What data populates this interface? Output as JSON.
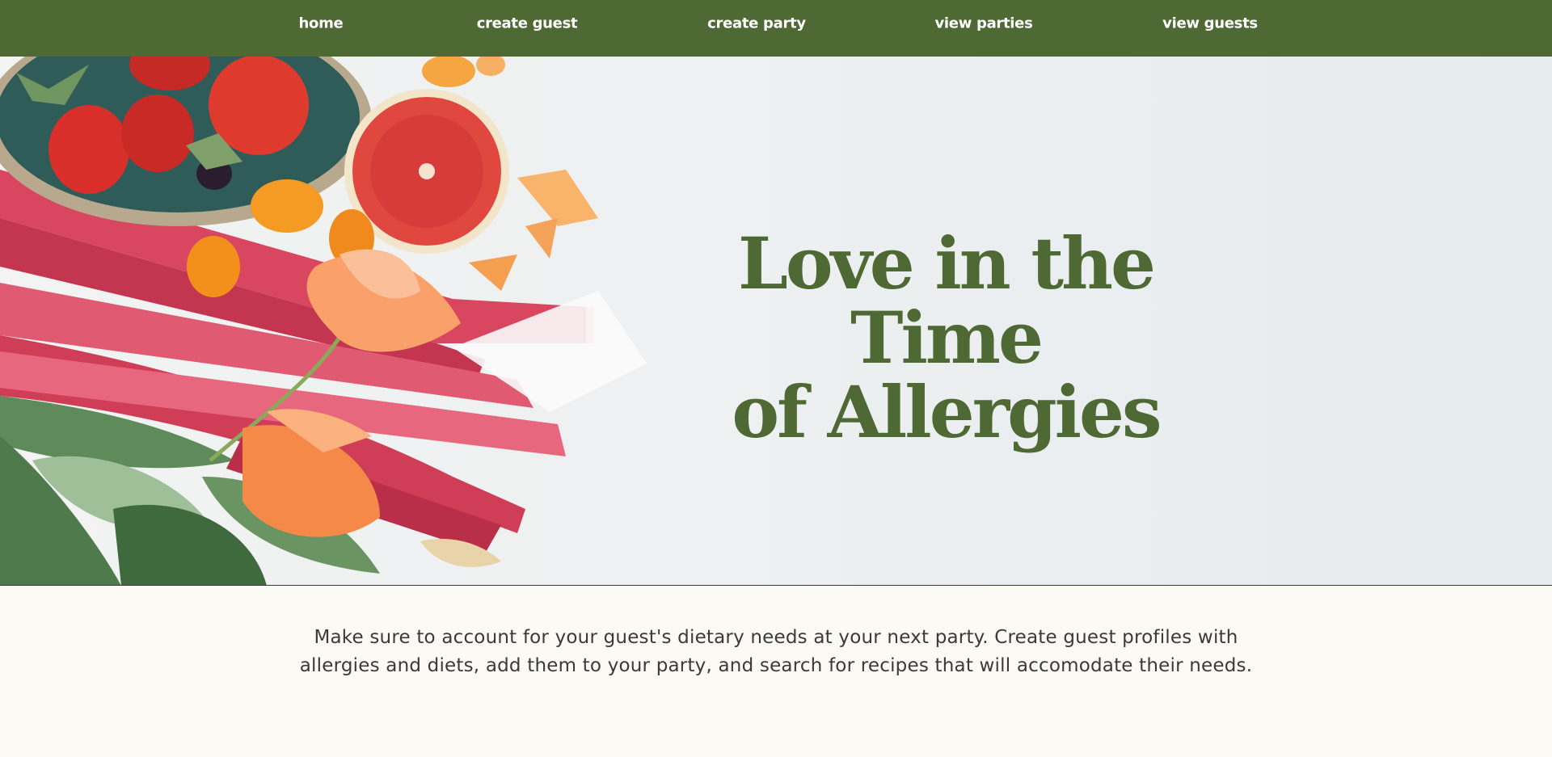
{
  "nav": {
    "items": [
      {
        "label": "home"
      },
      {
        "label": "create guest"
      },
      {
        "label": "create party"
      },
      {
        "label": "view parties"
      },
      {
        "label": "view guests"
      }
    ]
  },
  "hero": {
    "title_line1": "Love in the Time",
    "title_line2": "of Allergies"
  },
  "intro": {
    "text": "Make sure to account for your guest's dietary needs at your next party. Create guest profiles with allergies and diets, add them to your party, and search for recipes that will accomodate their needs."
  },
  "colors": {
    "nav_bg": "#4e6933",
    "title": "#4e6933",
    "page_bg": "#fcfaf4"
  }
}
